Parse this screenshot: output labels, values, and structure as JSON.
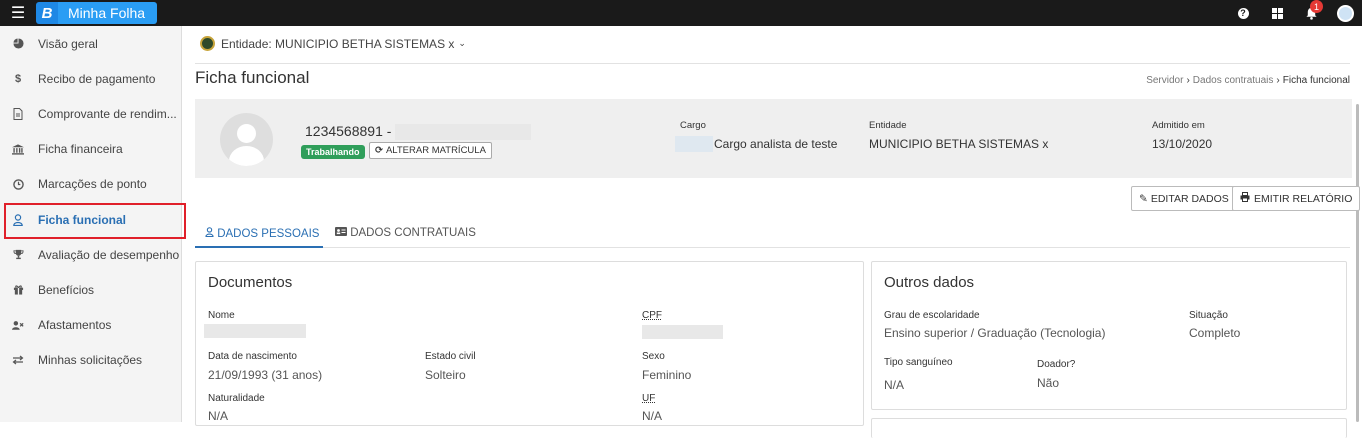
{
  "topbar": {
    "brand_letter": "B",
    "brand_name": "Minha Folha",
    "notification_count": "1",
    "icons": [
      "menu-icon",
      "help-icon",
      "apps-icon",
      "bell-icon",
      "user-avatar"
    ]
  },
  "sidebar": {
    "items": [
      {
        "label": "Visão geral",
        "icon": "pie-chart-icon"
      },
      {
        "label": "Recibo de pagamento",
        "icon": "dollar-icon"
      },
      {
        "label": "Comprovante de rendim...",
        "icon": "document-icon"
      },
      {
        "label": "Ficha financeira",
        "icon": "bank-icon"
      },
      {
        "label": "Marcações de ponto",
        "icon": "clock-icon"
      },
      {
        "label": "Ficha funcional",
        "icon": "user-icon",
        "active": true
      },
      {
        "label": "Avaliação de desempenho",
        "icon": "trophy-icon"
      },
      {
        "label": "Benefícios",
        "icon": "gift-icon"
      },
      {
        "label": "Afastamentos",
        "icon": "user-x-icon"
      },
      {
        "label": "Minhas solicitações",
        "icon": "exchange-icon"
      }
    ]
  },
  "entity": {
    "label": "Entidade: MUNICIPIO BETHA SISTEMAS x"
  },
  "page": {
    "title": "Ficha funcional",
    "breadcrumb": [
      "Servidor",
      "Dados contratuais",
      "Ficha funcional"
    ]
  },
  "profile": {
    "matricula": "1234568891 -",
    "status": "Trabalhando",
    "alterar_label": "ALTERAR MATRÍCULA",
    "cargo_label": "Cargo",
    "cargo_value": "Cargo analista de teste",
    "entidade_label": "Entidade",
    "entidade_value": "MUNICIPIO BETHA SISTEMAS x",
    "admitido_label": "Admitido em",
    "admitido_value": "13/10/2020"
  },
  "actions": {
    "editar": "EDITAR DADOS",
    "emitir": "EMITIR RELATÓRIO"
  },
  "tabs": [
    {
      "label": "DADOS PESSOAIS",
      "active": true
    },
    {
      "label": "DADOS CONTRATUAIS",
      "active": false
    }
  ],
  "documentos": {
    "title": "Documentos",
    "nome_label": "Nome",
    "cpf_label": "CPF",
    "nascimento_label": "Data de nascimento",
    "nascimento_value": "21/09/1993 (31 anos)",
    "estado_civil_label": "Estado civil",
    "estado_civil_value": "Solteiro",
    "sexo_label": "Sexo",
    "sexo_value": "Feminino",
    "naturalidade_label": "Naturalidade",
    "naturalidade_value": "N/A",
    "uf_label": "UF",
    "uf_value": "N/A"
  },
  "outros": {
    "title": "Outros dados",
    "escolaridade_label": "Grau de escolaridade",
    "escolaridade_value": "Ensino superior / Graduação (Tecnologia)",
    "situacao_label": "Situação",
    "situacao_value": "Completo",
    "sangue_label": "Tipo sanguíneo",
    "sangue_value": "N/A",
    "doador_label": "Doador?",
    "doador_value": "Não"
  }
}
